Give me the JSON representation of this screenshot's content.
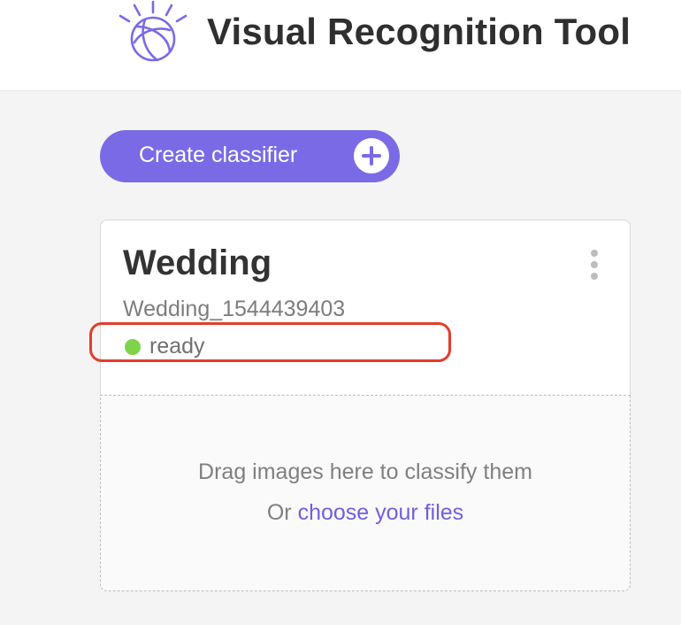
{
  "header": {
    "title": "Visual Recognition Tool",
    "logo_icon": "ibm-watson-logo-icon",
    "logo_color": "#7a6ae6"
  },
  "toolbar": {
    "create_label": "Create classifier",
    "create_icon": "plus-icon",
    "accent_color": "#7a6ae6"
  },
  "classifier": {
    "name": "Wedding",
    "id": "Wedding_1544439403",
    "status": "ready",
    "status_color": "#7ed34a",
    "menu_icon": "kebab-menu-icon"
  },
  "dropzone": {
    "instruction": "Drag images here to classify them",
    "or_text": "Or",
    "link_text": "choose your files",
    "link_color": "#6f5fe0"
  },
  "annotation": {
    "highlight_color": "#e53c2c"
  }
}
